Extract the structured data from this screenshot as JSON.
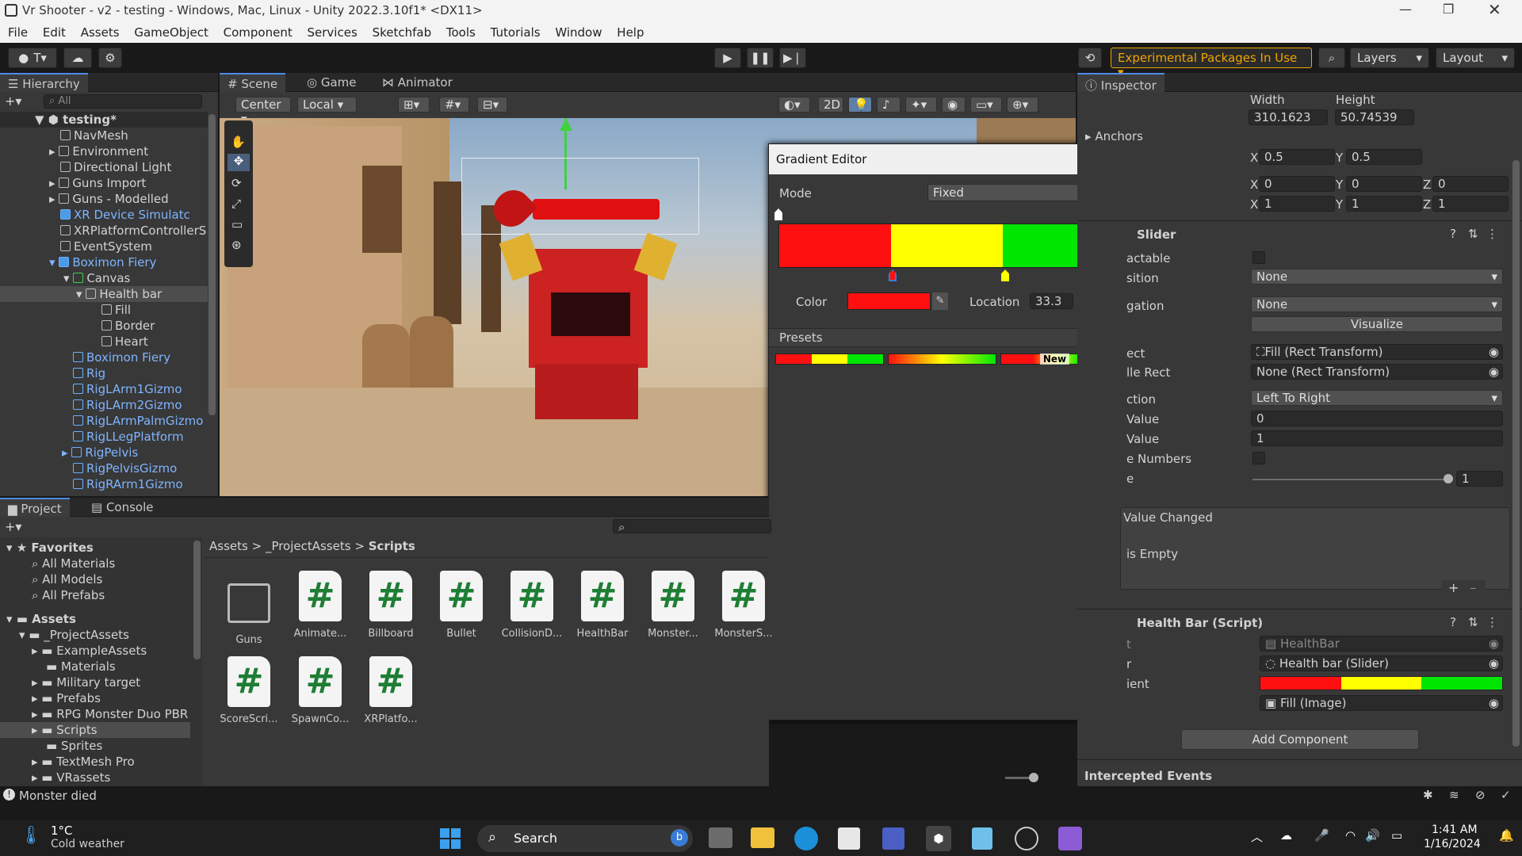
{
  "window": {
    "title": "Vr Shooter - v2 - testing - Windows, Mac, Linux - Unity 2022.3.10f1* <DX11>"
  },
  "menu": [
    "File",
    "Edit",
    "Assets",
    "GameObject",
    "Component",
    "Services",
    "Sketchfab",
    "Tools",
    "Tutorials",
    "Window",
    "Help"
  ],
  "toolbar": {
    "account": "T",
    "experimental": "Experimental Packages In Use",
    "layers": "Layers",
    "layout": "Layout"
  },
  "hierarchy": {
    "tab": "Hierarchy",
    "search_placeholder": "All",
    "scene": "testing*",
    "items": [
      {
        "label": "NavMesh"
      },
      {
        "label": "Environment"
      },
      {
        "label": "Directional Light"
      },
      {
        "label": "Guns Import"
      },
      {
        "label": "Guns - Modelled"
      },
      {
        "label": "XR Device Simulatc"
      },
      {
        "label": "XRPlatformControllerS"
      },
      {
        "label": "EventSystem"
      },
      {
        "label": "Boximon Fiery"
      },
      {
        "label": "Canvas"
      },
      {
        "label": "Health bar"
      },
      {
        "label": "Fill"
      },
      {
        "label": "Border"
      },
      {
        "label": "Heart"
      },
      {
        "label": "Boximon Fiery"
      },
      {
        "label": "Rig"
      },
      {
        "label": "RigLArm1Gizmo"
      },
      {
        "label": "RigLArm2Gizmo"
      },
      {
        "label": "RigLArmPalmGizmo"
      },
      {
        "label": "RigLLegPlatform"
      },
      {
        "label": "RigPelvis"
      },
      {
        "label": "RigPelvisGizmo"
      },
      {
        "label": "RigRArm1Gizmo"
      }
    ]
  },
  "scene": {
    "tabs": [
      "Scene",
      "Game",
      "Animator"
    ],
    "pivot": "Center",
    "space": "Local",
    "mode2d": "2D"
  },
  "gradient_editor": {
    "title": "Gradient Editor",
    "mode_label": "Mode",
    "mode_value": "Fixed",
    "color_label": "Color",
    "location_label": "Location",
    "location_value": "33.3",
    "percent": "%",
    "presets_label": "Presets",
    "new_label": "New",
    "colors": {
      "red": "#ff1010",
      "yellow": "#ffff00",
      "green": "#00e600"
    }
  },
  "project": {
    "tabs": [
      "Project",
      "Console"
    ],
    "favorites_label": "Favorites",
    "favorites": [
      "All Materials",
      "All Models",
      "All Prefabs"
    ],
    "assets_label": "Assets",
    "folders": [
      "_ProjectAssets",
      "ExampleAssets",
      "Materials",
      "Military target",
      "Prefabs",
      "RPG Monster Duo PBR",
      "Scripts",
      "Sprites",
      "TextMesh Pro",
      "VRassets"
    ],
    "breadcrumb": [
      "Assets",
      "_ProjectAssets",
      "Scripts"
    ],
    "files": [
      "Guns",
      "Animate...",
      "Billboard",
      "Bullet",
      "CollisionD...",
      "HealthBar",
      "Monster...",
      "MonsterS...",
      "ScoreScri...",
      "SpawnCo...",
      "XRPlatfo..."
    ]
  },
  "inspector": {
    "tab": "Inspector",
    "width_label": "Width",
    "height_label": "Height",
    "width": "310.1623",
    "height": "50.74539",
    "anchors": "Anchors",
    "pivot_x": "0.5",
    "pivot_y": "0.5",
    "rot": [
      "0",
      "0",
      "0"
    ],
    "scale": [
      "1",
      "1",
      "1"
    ],
    "x": "X",
    "y": "Y",
    "z": "Z",
    "slider_title": "Slider",
    "labels": [
      "actable",
      "sition",
      "gation",
      "ect",
      "lle Rect",
      "ction",
      "Value",
      "Value",
      "e Numbers",
      "e"
    ],
    "transition": "None",
    "navigation": "None",
    "visualize": "Visualize",
    "fill_rect": "Fill (Rect Transform)",
    "handle_rect": "None (Rect Transform)",
    "direction": "Left To Right",
    "min_value": "0",
    "max_value": "1",
    "value": "1",
    "on_value_changed": "Value Changed",
    "list_empty": "is Empty",
    "healthbar_title": "Health Bar (Script)",
    "hb_labels": [
      "t",
      "r",
      "ient"
    ],
    "hb_script": "HealthBar",
    "hb_slider": "Health bar (Slider)",
    "hb_fill": "Fill (Image)",
    "add_component": "Add Component",
    "intercepted": "Intercepted Events"
  },
  "status": {
    "message": "Monster died"
  },
  "taskbar": {
    "weather_temp": "1°C",
    "weather_desc": "Cold weather",
    "search": "Search",
    "time": "1:41 AM",
    "date": "1/16/2024"
  }
}
